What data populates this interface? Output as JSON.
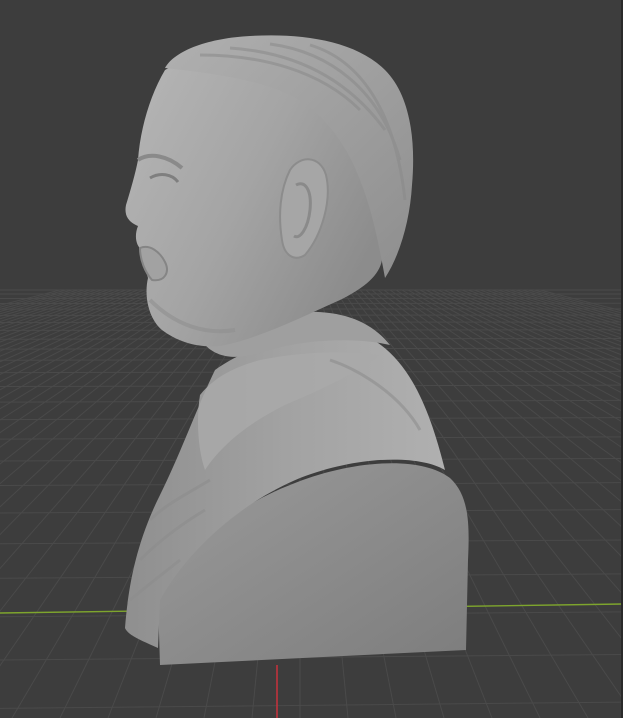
{
  "viewport": {
    "background_color": "#3d3d3d",
    "grid_color": "#4a4a4a",
    "x_axis_color": "#7ea52d",
    "y_axis_color": "#c1323d",
    "model_color": "#9a9a9a",
    "model_name": "bust-sculpture"
  }
}
